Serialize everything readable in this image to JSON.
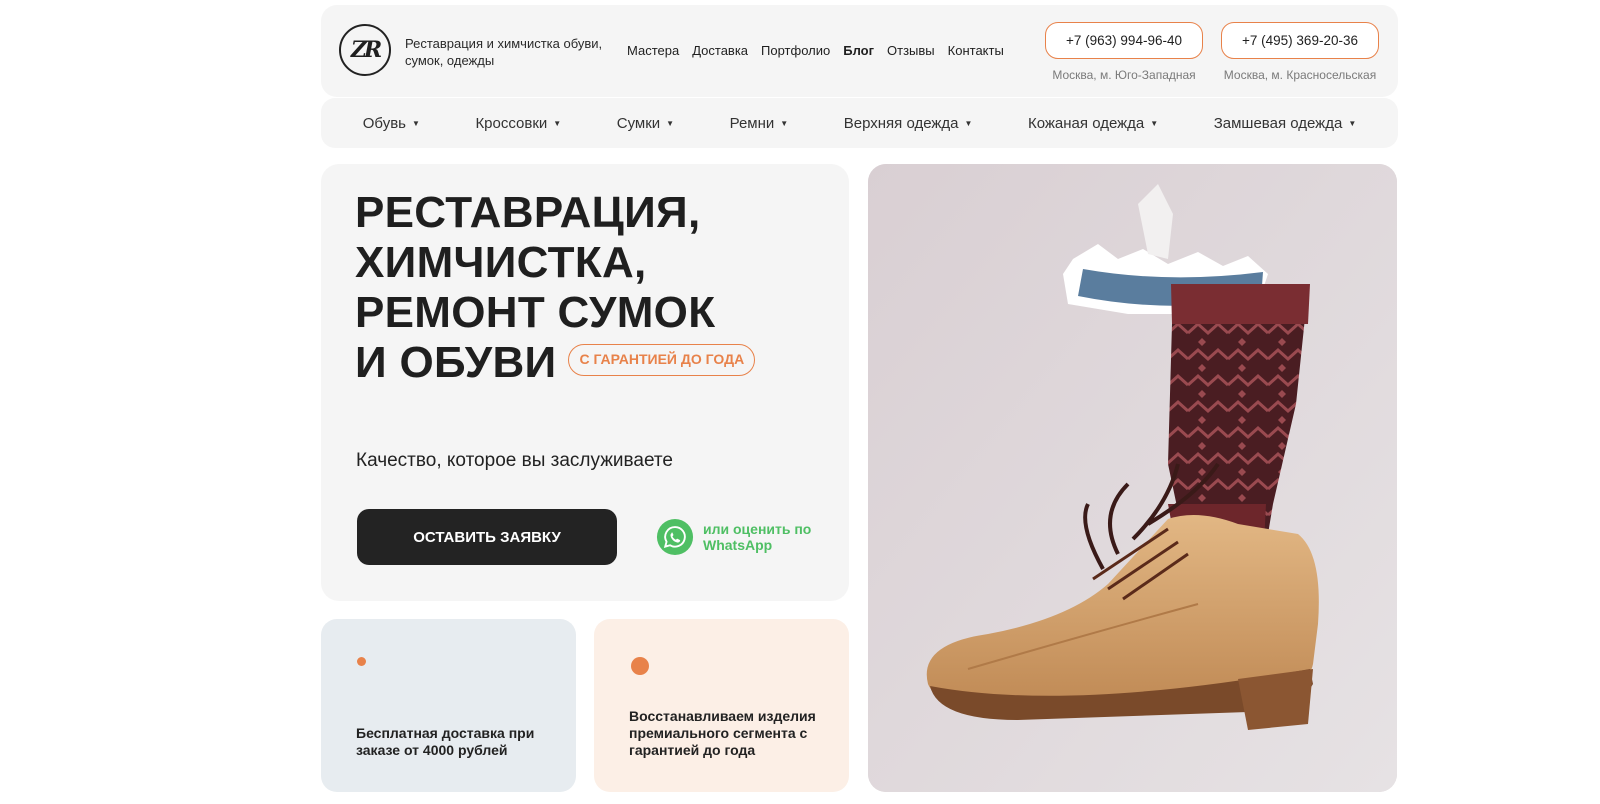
{
  "brand": {
    "tagline": "Реставрация и химчистка обуви, сумок, одежды",
    "logo_letters": "ZR"
  },
  "nav": {
    "items": [
      "Мастера",
      "Доставка",
      "Портфолио",
      "Блог",
      "Отзывы",
      "Контакты"
    ]
  },
  "contacts": [
    {
      "phone": "+7 (963) 994-96-40",
      "location": "Москва, м. Юго-Западная"
    },
    {
      "phone": "+7 (495) 369-20-36",
      "location": "Москва, м. Красносельская"
    }
  ],
  "categories": [
    "Обувь",
    "Кроссовки",
    "Сумки",
    "Ремни",
    "Верхняя одежда",
    "Кожаная одежда",
    "Замшевая одежда"
  ],
  "hero": {
    "title_lines": [
      "РЕСТАВРАЦИЯ,",
      "ХИМЧИСТКА,",
      "РЕМОНТ СУМОК",
      "И ОБУВИ"
    ],
    "badge": "С ГАРАНТИЕЙ ДО ГОДА",
    "subtitle": "Качество, которое вы заслуживаете",
    "cta_label": "ОСТАВИТЬ ЗАЯВКУ",
    "whatsapp_label": "или оценить по WhatsApp"
  },
  "features": [
    {
      "text": "Бесплатная доставка при заказе от 4000 рублей"
    },
    {
      "text": "Восстанавливаем изделия премиального сегмента с гарантией до года"
    }
  ],
  "colors": {
    "accent": "#e8824a",
    "dark": "#232323",
    "whatsapp": "#4fbf64",
    "card_bg": "#f5f5f5"
  },
  "icons": {
    "logo": "zr-monogram-icon",
    "whatsapp": "whatsapp-icon",
    "dropdown": "caret-down-icon"
  }
}
